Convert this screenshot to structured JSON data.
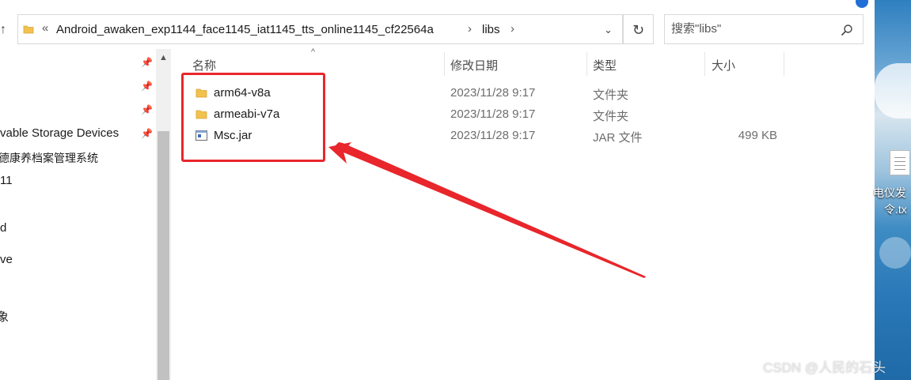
{
  "menu": {
    "items": [
      "",
      "",
      ""
    ]
  },
  "address": {
    "overflow_chevron": "«",
    "path": "Android_awaken_exp1144_face1145_iat1145_tts_online1145_cf22564a",
    "separator": "›",
    "current_folder": "libs",
    "dropdown": "⌄",
    "refresh": "↻"
  },
  "search": {
    "placeholder": "搜索\"libs\""
  },
  "nav": {
    "items": [
      "vable Storage Devices",
      "德康养档案管理系统",
      "11",
      "d",
      "ve",
      "象"
    ]
  },
  "columns": {
    "name": "名称",
    "date": "修改日期",
    "type": "类型",
    "size": "大小"
  },
  "files": [
    {
      "name": "arm64-v8a",
      "date": "2023/11/28 9:17",
      "type": "文件夹",
      "size": "",
      "icon": "folder-icon"
    },
    {
      "name": "armeabi-v7a",
      "date": "2023/11/28 9:17",
      "type": "文件夹",
      "size": "",
      "icon": "folder-icon"
    },
    {
      "name": "Msc.jar",
      "date": "2023/11/28 9:17",
      "type": "JAR 文件",
      "size": "499 KB",
      "icon": "jar-file-icon"
    }
  ],
  "desktop": {
    "file_label_1": "电仪发",
    "file_label_2": "令.tx"
  },
  "watermark": "CSDN @人民的石头",
  "colors": {
    "annotation": "#e8262b",
    "folder": "#f2c14e",
    "accent": "#1f6fd6"
  }
}
